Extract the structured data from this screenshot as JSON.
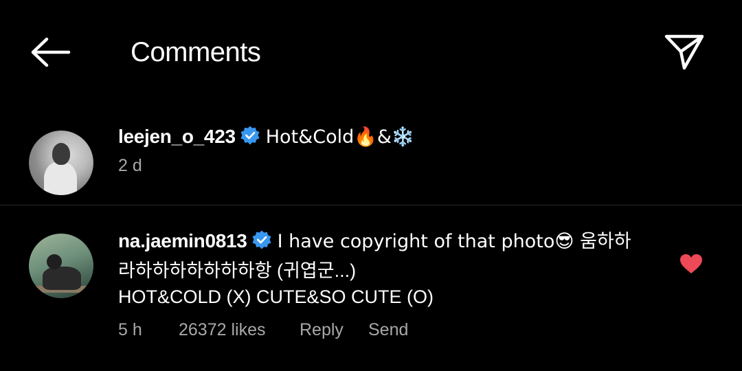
{
  "header": {
    "title": "Comments"
  },
  "caption": {
    "username": "leejen_o_423",
    "text": "Hot&Cold🔥&❄️",
    "time": "2 d"
  },
  "reply": {
    "username": "na.jaemin0813",
    "line1": "I have copyright of that photo😎 움하하",
    "line2": "라하하하하하하하항 (귀엽군...)",
    "line3": "HOT&COLD (X)  CUTE&SO CUTE (O)",
    "time": "5 h",
    "likes": "26372 likes",
    "reply_label": "Reply",
    "send_label": "Send",
    "liked": true
  },
  "colors": {
    "background": "#000000",
    "text": "#ffffff",
    "meta": "#a8a8a8",
    "verified": "#3897f0",
    "heart": "#ed4956",
    "divider": "#262626"
  },
  "icons": {
    "back": "arrow-left-icon",
    "share": "paper-plane-icon",
    "verified": "verified-badge-icon",
    "like": "heart-icon"
  }
}
